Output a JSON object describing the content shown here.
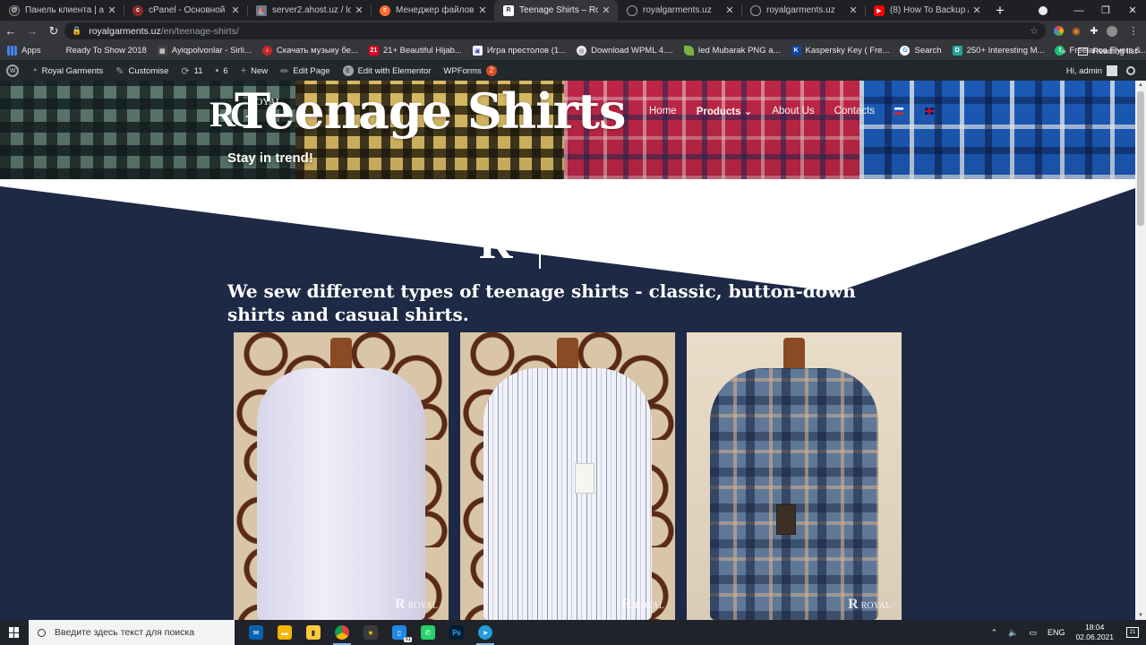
{
  "browser": {
    "tabs": [
      {
        "title": "Панель клиента | aHOST",
        "favicon": "ahost-icon",
        "color": "#2a2a2a",
        "active": false
      },
      {
        "title": "cPanel - Основной",
        "favicon": "cpanel-icon",
        "color": "#c0392b",
        "active": false
      },
      {
        "title": "server2.ahost.uz / localhost",
        "favicon": "phpmyadmin-icon",
        "color": "#e67e22",
        "active": false
      },
      {
        "title": "Менеджер файлов cPanel",
        "favicon": "cpanel-icon",
        "color": "#ff6c2c",
        "active": false
      },
      {
        "title": "Teenage Shirts – Royal Garments",
        "favicon": "royal-garments-icon",
        "color": "#ffffff",
        "active": true
      },
      {
        "title": "royalgarments.uz",
        "favicon": "globe-icon",
        "color": "#5f6368",
        "active": false
      },
      {
        "title": "royalgarments.uz",
        "favicon": "globe-icon",
        "color": "#5f6368",
        "active": false
      },
      {
        "title": "(8) How To Backup And Restore",
        "favicon": "youtube-icon",
        "color": "#ff0000",
        "active": false
      }
    ],
    "new_tab_label": "+",
    "url_host": "royalgarments.uz",
    "url_path": "/en/teenage-shirts/"
  },
  "bookmarks": {
    "items": [
      {
        "label": "Apps",
        "icon": "apps-grid-icon",
        "color": "#4285f4"
      },
      {
        "label": "Ready To Show 2018",
        "icon": "bookmark-icon",
        "color": "#888888"
      },
      {
        "label": "Ayiqpolvonlar - Sirli...",
        "icon": "film-icon",
        "color": "#444444"
      },
      {
        "label": "Скачать музыку бе...",
        "icon": "music-icon",
        "color": "#c62828"
      },
      {
        "label": "21+ Beautiful Hijab...",
        "icon": "pinterest-icon",
        "color": "#e60023"
      },
      {
        "label": "Игра престолов (1...",
        "icon": "tv-icon",
        "color": "#3f51b5"
      },
      {
        "label": "Download WPML 4....",
        "icon": "globe-icon",
        "color": "#5f6368"
      },
      {
        "label": "Ied Mubarak PNG a...",
        "icon": "leaf-icon",
        "color": "#7cb342"
      },
      {
        "label": "Kaspersky Key ( Fre...",
        "icon": "kaspersky-icon",
        "color": "#0d47a1"
      },
      {
        "label": "Search",
        "icon": "google-icon",
        "color": "#ffffff"
      },
      {
        "label": "250+ Interesting M...",
        "icon": "bookmark-icon",
        "color": "#26a69a"
      },
      {
        "label": "Freelance Flyers &...",
        "icon": "freelancer-icon",
        "color": "#1dbf73"
      }
    ],
    "overflow": "»",
    "reading_list": "Reading list"
  },
  "wp_admin": {
    "site_name": "Royal Garments",
    "customise": "Customise",
    "updates": "11",
    "comments": "6",
    "new": "New",
    "edit_page": "Edit Page",
    "elementor": "Edit with Elementor",
    "wpforms": "WPForms",
    "wpforms_badge": "2",
    "greeting": "Hi, admin"
  },
  "site": {
    "logo_letters": "RG",
    "logo_word": "ROYAL",
    "page_title": "Teenage Shirts",
    "tagline": "Stay in trend!",
    "nav": [
      {
        "label": "Home",
        "active": false
      },
      {
        "label": "Products ⌄",
        "active": true
      },
      {
        "label": "About Us",
        "active": false
      },
      {
        "label": "Contacts",
        "active": false
      }
    ],
    "deco_letter": "R",
    "intro": "We sew different types of teenage shirts - classic, button-down shirts and casual shirts.",
    "photos": [
      {
        "style": "white",
        "watermark": "ROYAL"
      },
      {
        "style": "stripe",
        "watermark": "ROYAL"
      },
      {
        "style": "plaid",
        "watermark": "ROYAL"
      }
    ]
  },
  "taskbar": {
    "search_placeholder": "Введите здесь текст для поиска",
    "apps": [
      {
        "name": "mail-icon",
        "color": "#0a64ad"
      },
      {
        "name": "file-explorer-icon",
        "color": "#f4b400"
      },
      {
        "name": "sticky-notes-icon",
        "color": "#ffc83d"
      },
      {
        "name": "chrome-icon",
        "color": "#db4437"
      },
      {
        "name": "star-app-icon",
        "color": "#3b3b3b"
      },
      {
        "name": "phone-app-icon",
        "color": "#1e88e5"
      },
      {
        "name": "whatsapp-icon",
        "color": "#25d366"
      },
      {
        "name": "photoshop-icon",
        "color": "#001e36"
      },
      {
        "name": "telegram-icon",
        "color": "#229ed9"
      }
    ],
    "app_badge": "91",
    "lang": "ENG",
    "time": "18:04",
    "date": "02.06.2021",
    "notifications": "21"
  }
}
